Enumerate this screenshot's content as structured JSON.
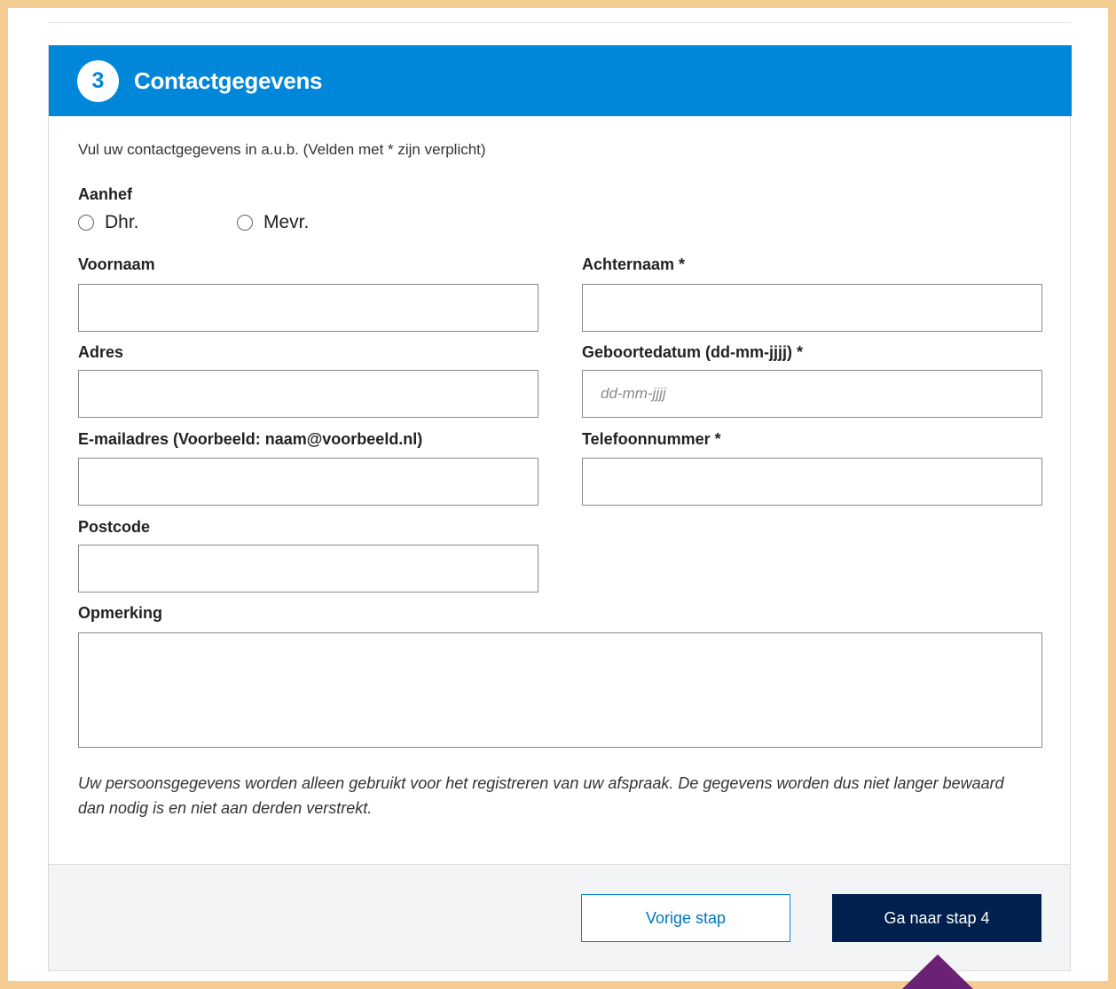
{
  "section": {
    "step_number": "3",
    "title": "Contactgegevens",
    "intro": "Vul uw contactgegevens in a.u.b. (Velden met * zijn verplicht)"
  },
  "salutation": {
    "label": "Aanhef",
    "options": [
      "Dhr.",
      "Mevr."
    ]
  },
  "fields": {
    "firstname": {
      "label": "Voornaam",
      "value": ""
    },
    "lastname": {
      "label": "Achternaam *",
      "value": ""
    },
    "address": {
      "label": "Adres",
      "value": ""
    },
    "birthdate": {
      "label": "Geboortedatum (dd-mm-jjjj) *",
      "placeholder": "dd-mm-jjjj",
      "value": ""
    },
    "email": {
      "label": "E-mailadres (Voorbeeld: naam@voorbeeld.nl)",
      "value": ""
    },
    "phone": {
      "label": "Telefoonnummer *",
      "value": ""
    },
    "postcode": {
      "label": "Postcode",
      "value": ""
    },
    "remark": {
      "label": "Opmerking",
      "value": ""
    }
  },
  "privacy_note": "Uw persoonsgegevens worden alleen gebruikt voor het registreren van uw afspraak. De gegevens worden dus niet langer bewaard dan nodig is en niet aan derden verstrekt.",
  "buttons": {
    "previous": "Vorige stap",
    "next": "Ga naar stap 4"
  },
  "colors": {
    "header": "#0087d9",
    "primary_button": "#00204d",
    "frame": "#f5cc92",
    "pointer": "#6b2275"
  }
}
